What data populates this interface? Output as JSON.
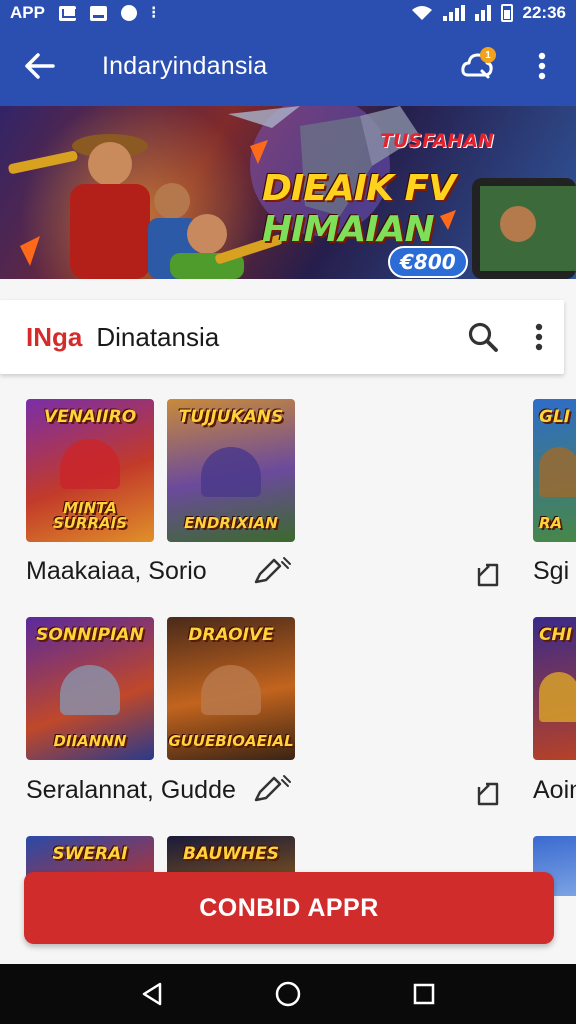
{
  "status_bar": {
    "app_label": "APP",
    "time": "22:36"
  },
  "app_bar": {
    "title": "Indaryindansia",
    "notification_count": "1"
  },
  "banner": {
    "kicker": "TUSFAHAN",
    "title_part1": "DIEAIK FV ",
    "title_part2": "HIMAIAN",
    "price": "€800",
    "colors": {
      "title": "#ffd21e",
      "accent": "#7ee05a"
    }
  },
  "search_card": {
    "brand": "INga",
    "title": "Dinatansia"
  },
  "grid": {
    "row1": {
      "tiles": [
        {
          "top": "VENAIIRO",
          "bottom": "MINTA SURRAIS"
        },
        {
          "top": "TUJJUKANS",
          "bottom": "ENDRIXIAN"
        },
        {
          "top": "GLI",
          "bottom": "RA"
        }
      ],
      "label": "Maakaiaa, Sorio",
      "cut_label": "Sgi"
    },
    "row2": {
      "tiles": [
        {
          "top": "SONNIPIAN",
          "bottom": "DIIANNN"
        },
        {
          "top": "DRAOIVE",
          "bottom": "GUUEBIOAEIAL"
        },
        {
          "top": "CHI",
          "bottom": ""
        }
      ],
      "label": "Seralannat, Gudde",
      "cut_label": "Aoin"
    },
    "row3": {
      "tiles": [
        {
          "top": "SWERAI",
          "bottom": ""
        },
        {
          "top": "BAUWHES",
          "bottom": ""
        }
      ]
    }
  },
  "cta": {
    "label": "CONBID APPR"
  },
  "nav": {
    "back": "back-icon",
    "home": "home-icon",
    "recents": "recents-icon"
  }
}
